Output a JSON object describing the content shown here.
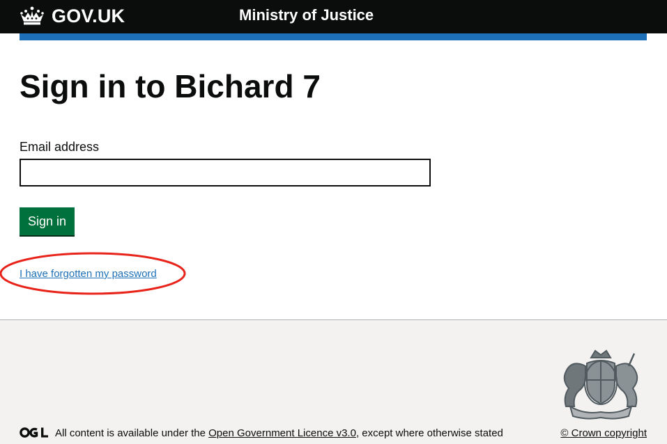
{
  "header": {
    "logo_text": "GOV.UK",
    "service_name": "Ministry of Justice"
  },
  "main": {
    "title": "Sign in to Bichard 7",
    "email_label": "Email address",
    "email_value": "",
    "signin_label": "Sign in",
    "forgot_password_link": "I have forgotten my password"
  },
  "annotation": {
    "color": "#e8231a",
    "shape": "ellipse"
  },
  "footer": {
    "licence_prefix": "All content is available under the ",
    "licence_link": "Open Government Licence v3.0",
    "licence_suffix": ", except where otherwise stated",
    "copyright": "© Crown copyright"
  },
  "colors": {
    "header_bg": "#0b0c0c",
    "accent_blue": "#1d70b8",
    "button_green": "#00703c",
    "footer_bg": "#f3f2f1"
  },
  "icons": [
    "crown-icon",
    "open-government-licence-icon",
    "royal-coat-of-arms-icon"
  ]
}
